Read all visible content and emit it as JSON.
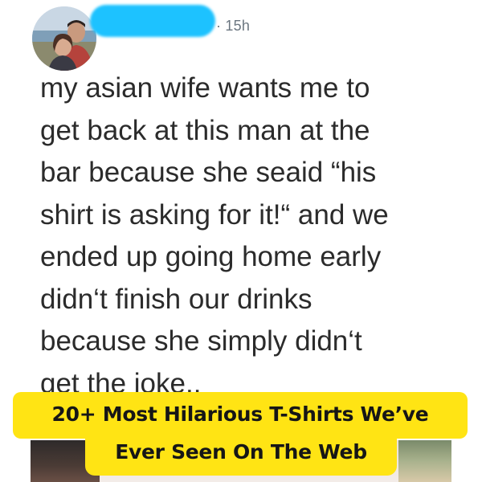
{
  "post": {
    "timestamp": "· 15h",
    "lines": [
      "my asian wife wants me to",
      "get back at this man at the",
      "bar because she seaid “his",
      "shirt is asking for it!“ and we",
      "ended up going home early",
      "didn‘t finish our drinks",
      "because she simply didn‘t",
      "get the joke.."
    ]
  },
  "banner": {
    "line1": "20+ Most Hilarious T-Shirts We’ve",
    "line2": "Ever Seen On The Web"
  },
  "colors": {
    "banner": "#ffe414",
    "redaction": "#1dc2ff",
    "text": "#2b2b2b",
    "meta": "#6b7680"
  }
}
